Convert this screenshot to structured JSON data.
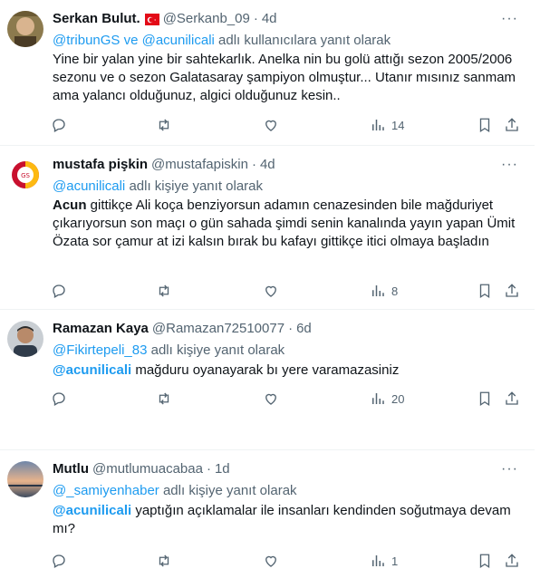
{
  "tweets": [
    {
      "name": "Serkan Bulut.",
      "handle": "@Serkanb_09",
      "time": "4d",
      "reply_mentions": "@tribunGS ve @acunilicali",
      "reply_suffix": "adlı kullanıcılara yanıt olarak",
      "body": "Yine bir yalan yine bir sahtekarlık. Anelka nin bu golü attığı sezon 2005/2006 sezonu ve o sezon Galatasaray şampiyon olmuştur... Utanır mısınız sanmam ama yalancı olduğunuz, algici olduğunuz kesin..",
      "views": "14"
    },
    {
      "name": "mustafa pişkin",
      "handle": "@mustafapiskin",
      "time": "4d",
      "reply_mentions": "@acunilicali",
      "reply_suffix": "adlı kişiye yanıt olarak",
      "body_bold": "Acun",
      "body": " gittikçe Ali koça benziyorsun adamın cenazesinden bile mağduriyet çıkarıyorsun son maçı o gün sahada şimdi senin kanalında yayın yapan Ümit Özata sor çamur at izi kalsın bırak bu kafayı gittikçe itici olmaya başladın",
      "views": "8"
    },
    {
      "name": "Ramazan Kaya",
      "handle": "@Ramazan72510077",
      "time": "6d",
      "reply_mentions": "@Fikirtepeli_83",
      "reply_suffix": "adlı kişiye yanıt olarak",
      "body_mention": "@acunilicali",
      "body": " mağduru oyanayarak bı yere varamazasiniz",
      "views": "20"
    },
    {
      "name": "Mutlu",
      "handle": "@mutlumuacabaa",
      "time": "1d",
      "reply_mentions": "@_samiyenhaber",
      "reply_suffix": "adlı kişiye yanıt olarak",
      "body_mention": "@acunilicali",
      "body": " yaptığın açıklamalar ile insanları kendinden soğutmaya devam mı?",
      "views": "1"
    }
  ],
  "dot": "·",
  "more": "···",
  "colors": {
    "link": "#1d9bf0",
    "muted": "#536471",
    "text": "#0f1419"
  },
  "icons": [
    "reply-icon",
    "retweet-icon",
    "like-icon",
    "views-icon",
    "bookmark-icon",
    "share-icon"
  ]
}
